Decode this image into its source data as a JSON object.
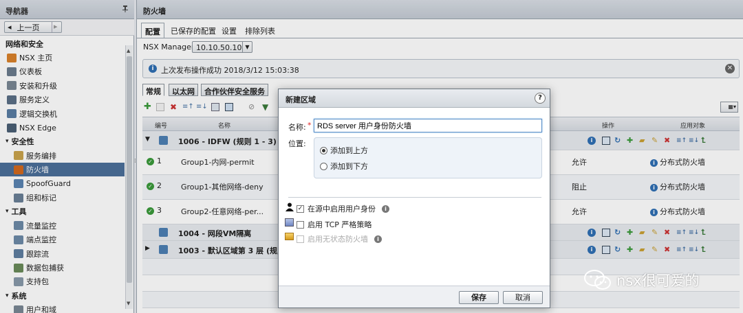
{
  "navigator": {
    "title": "导航器",
    "pin": "⯒",
    "back": "上一页",
    "section_title": "网络和安全",
    "items": [
      {
        "label": "NSX 主页",
        "icon": "home-grid-icon",
        "color": "#d9822b"
      },
      {
        "label": "仪表板",
        "icon": "dashboard-icon",
        "color": "#6b7b8c"
      },
      {
        "label": "安装和升级",
        "icon": "gear-icon",
        "color": "#7a8794"
      },
      {
        "label": "服务定义",
        "icon": "service-icon",
        "color": "#5b6f86"
      },
      {
        "label": "逻辑交换机",
        "icon": "switch-icon",
        "color": "#5a7da3"
      },
      {
        "label": "NSX Edge",
        "icon": "edge-icon",
        "color": "#4a5f75"
      },
      {
        "label": "安全性",
        "section": true
      },
      {
        "label": "服务编排",
        "icon": "compose-icon",
        "color": "#c9a34c"
      },
      {
        "label": "防火墙",
        "icon": "firewall-icon",
        "color": "#d2691e",
        "selected": true
      },
      {
        "label": "SpoofGuard",
        "icon": "spoofguard-icon",
        "color": "#5b84b1"
      },
      {
        "label": "组和标记",
        "icon": "tag-icon",
        "color": "#6a7f96"
      },
      {
        "label": "工具",
        "section": true
      },
      {
        "label": "流量监控",
        "icon": "flow-monitor-icon",
        "color": "#6d8aa8"
      },
      {
        "label": "端点监控",
        "icon": "endpoint-icon",
        "color": "#6d8aa8"
      },
      {
        "label": "跟踪流",
        "icon": "traceflow-icon",
        "color": "#5f7ea0"
      },
      {
        "label": "数据包捕获",
        "icon": "capture-icon",
        "color": "#6a8a5a"
      },
      {
        "label": "支持包",
        "icon": "bundle-icon",
        "color": "#8899aa"
      },
      {
        "label": "系统",
        "section": true
      },
      {
        "label": "用户和域",
        "icon": "users-icon",
        "color": "#7a8794"
      }
    ]
  },
  "main": {
    "title": "防火墙",
    "tabs": [
      "配置",
      "已保存的配置",
      "设置",
      "排除列表"
    ],
    "manager_label": "NSX Manager:",
    "manager_value": "10.10.50.10",
    "info_text": "上次发布操作成功 2018/3/12 15:03:38",
    "subtabs": [
      "常规",
      "以太网",
      "合作伙伴安全服务"
    ],
    "grid_headers": {
      "no": "编号",
      "name": "名称",
      "action": "操作",
      "applied": "应用对象"
    },
    "sections": [
      {
        "label": "1006 - IDFW (规则 1 - 3)"
      },
      {
        "label": "1004 - 网段VM隔离"
      },
      {
        "label": "1003 - 默认区域第 3 层 (规则 4"
      }
    ],
    "rules": [
      {
        "no": "1",
        "name": "Group1-内网-permit",
        "action": "允许",
        "applied": "分布式防火墙"
      },
      {
        "no": "2",
        "name": "Group1-其他网络-deny",
        "action": "阻止",
        "applied": "分布式防火墙"
      },
      {
        "no": "3",
        "name": "Group2-任意网络-per...",
        "action": "允许",
        "applied": "分布式防火墙"
      }
    ]
  },
  "dialog": {
    "title": "新建区域",
    "help": "?",
    "name_label": "名称:",
    "required_mark": "*",
    "name_value": "RDS server 用户身份防火墙",
    "position_label": "位置:",
    "options_position": [
      "添加到上方",
      "添加到下方"
    ],
    "opt_identity": "在源中启用用户身份",
    "opt_tcp": "启用 TCP 严格策略",
    "opt_stateless": "启用无状态防火墙",
    "save": "保存",
    "cancel": "取消"
  },
  "watermark": "nsx很可爱的",
  "colors": {
    "selected": "#4b6f99",
    "accent": "#2f6fb3",
    "ok": "#3a9a3a",
    "danger": "#d22"
  }
}
